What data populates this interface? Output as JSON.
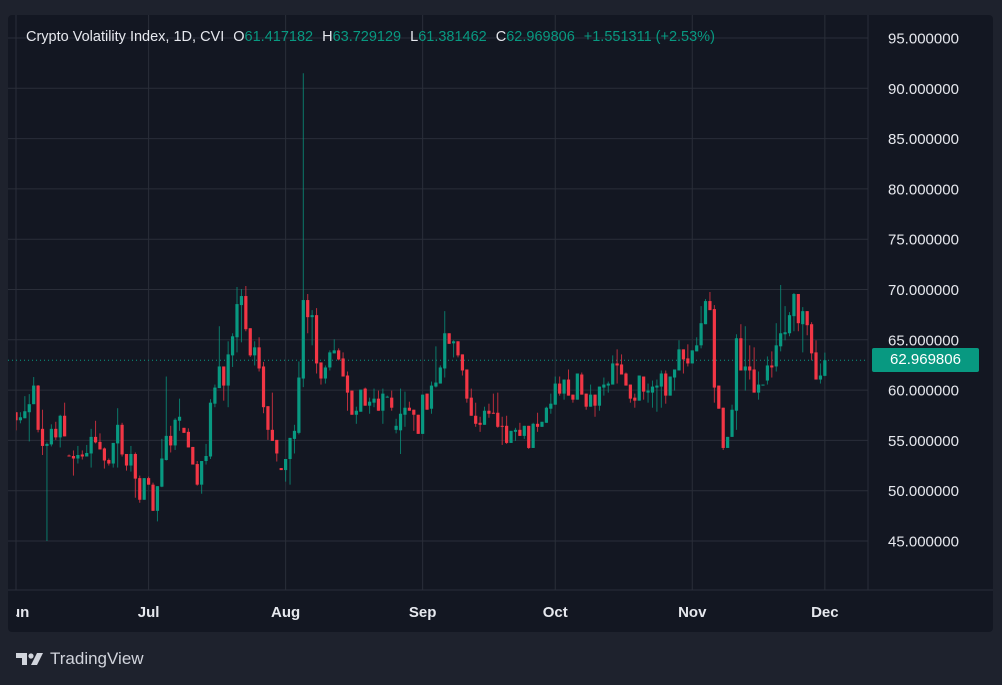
{
  "header": {
    "title": "Crypto Volatility Index, 1D, CVI",
    "open_label": "O",
    "open": "61.417182",
    "high_label": "H",
    "high": "63.729129",
    "low_label": "L",
    "low": "61.381462",
    "close_label": "C",
    "close": "62.969806",
    "change": "+1.551311 (+2.53%)"
  },
  "last_price": "62.969806",
  "branding": "TradingView",
  "colors": {
    "up": "#089981",
    "down": "#f23645",
    "background": "#131722",
    "grid": "#2a2e39"
  },
  "chart_data": {
    "type": "candlestick",
    "title": "Crypto Volatility Index, 1D, CVI",
    "interval": "1D",
    "ylim": [
      40,
      97
    ],
    "y_ticks": [
      "95.000000",
      "90.000000",
      "85.000000",
      "80.000000",
      "75.000000",
      "70.000000",
      "65.000000",
      "60.000000",
      "55.000000",
      "50.000000",
      "45.000000"
    ],
    "y_tick_values": [
      95,
      90,
      85,
      80,
      75,
      70,
      65,
      60,
      55,
      50,
      45
    ],
    "x_ticks": [
      {
        "label": "Jun",
        "index": 0
      },
      {
        "label": "Jul",
        "index": 30
      },
      {
        "label": "Aug",
        "index": 61
      },
      {
        "label": "Sep",
        "index": 92
      },
      {
        "label": "Oct",
        "index": 122
      },
      {
        "label": "Nov",
        "index": 153
      },
      {
        "label": "Dec",
        "index": 183
      }
    ],
    "grid": true,
    "last_value": 62.969806,
    "ohlc_fields": [
      "open",
      "high",
      "low",
      "close"
    ],
    "candles": [
      [
        57.8,
        57.8,
        56.0,
        57.0
      ],
      [
        57.0,
        57.8,
        56.7,
        57.3
      ],
      [
        57.2,
        59.4,
        57.2,
        57.9
      ],
      [
        57.8,
        59.6,
        54.9,
        58.6
      ],
      [
        58.6,
        61.3,
        58.6,
        60.45
      ],
      [
        60.45,
        60.5,
        55.8,
        56.05
      ],
      [
        56.15,
        58.05,
        53.55,
        54.45
      ],
      [
        54.45,
        54.8,
        45.0,
        54.65
      ],
      [
        54.6,
        56.6,
        54.4,
        56.15
      ],
      [
        56.15,
        56.85,
        55.05,
        55.3
      ],
      [
        55.3,
        57.55,
        54.3,
        57.45
      ],
      [
        57.45,
        58.75,
        55.4,
        55.4
      ],
      [
        53.5,
        53.6,
        53.4,
        53.4
      ],
      [
        53.45,
        54.0,
        51.5,
        53.2
      ],
      [
        53.2,
        54.45,
        52.7,
        53.55
      ],
      [
        53.6,
        54.0,
        53.1,
        53.4
      ],
      [
        53.4,
        54.55,
        53.4,
        53.75
      ],
      [
        53.7,
        56.15,
        52.3,
        55.35
      ],
      [
        55.35,
        56.95,
        54.7,
        54.8
      ],
      [
        54.85,
        55.7,
        54.1,
        54.1
      ],
      [
        54.2,
        54.3,
        52.2,
        53.0
      ],
      [
        53.05,
        53.2,
        52.5,
        52.7
      ],
      [
        52.7,
        54.75,
        52.3,
        54.75
      ],
      [
        54.7,
        58.2,
        52.3,
        56.55
      ],
      [
        56.55,
        56.75,
        53.4,
        53.6
      ],
      [
        53.65,
        53.65,
        52.0,
        52.5
      ],
      [
        52.5,
        54.45,
        51.9,
        53.65
      ],
      [
        53.65,
        53.8,
        49.3,
        51.2
      ],
      [
        51.25,
        51.5,
        48.8,
        49.1
      ],
      [
        49.1,
        51.25,
        49.1,
        51.25
      ],
      [
        51.25,
        51.4,
        50.6,
        50.6
      ],
      [
        50.6,
        50.8,
        48.0,
        48.0
      ],
      [
        48.0,
        50.45,
        46.95,
        50.45
      ],
      [
        50.4,
        55.15,
        50.35,
        53.2
      ],
      [
        53.05,
        61.35,
        53.0,
        55.45
      ],
      [
        55.45,
        56.45,
        53.8,
        54.5
      ],
      [
        54.5,
        57.2,
        54.05,
        57.05
      ],
      [
        56.95,
        59.15,
        55.95,
        57.35
      ],
      [
        56.25,
        56.25,
        55.75,
        55.75
      ],
      [
        55.85,
        56.2,
        54.3,
        54.3
      ],
      [
        54.35,
        54.35,
        52.6,
        52.6
      ],
      [
        52.65,
        52.95,
        50.5,
        50.6
      ],
      [
        50.6,
        52.95,
        49.7,
        52.95
      ],
      [
        52.95,
        54.65,
        52.6,
        53.45
      ],
      [
        53.4,
        59.1,
        53.15,
        58.75
      ],
      [
        58.65,
        60.55,
        58.3,
        60.25
      ],
      [
        60.2,
        66.35,
        60.2,
        62.35
      ],
      [
        62.35,
        62.35,
        58.95,
        60.45
      ],
      [
        60.45,
        64.85,
        58.3,
        63.55
      ],
      [
        63.45,
        65.65,
        62.3,
        65.35
      ],
      [
        65.25,
        70.25,
        63.75,
        68.55
      ],
      [
        68.45,
        70.05,
        64.75,
        69.35
      ],
      [
        69.35,
        70.35,
        65.85,
        66.05
      ],
      [
        66.15,
        66.15,
        63.3,
        63.45
      ],
      [
        63.45,
        64.85,
        62.45,
        64.25
      ],
      [
        64.25,
        65.25,
        61.85,
        62.15
      ],
      [
        62.35,
        62.8,
        57.7,
        58.3
      ],
      [
        58.4,
        58.4,
        55.05,
        56.05
      ],
      [
        56.05,
        59.75,
        54.95,
        54.95
      ],
      [
        55.05,
        55.05,
        52.9,
        53.7
      ],
      [
        52.25,
        52.25,
        52.05,
        52.05
      ],
      [
        52.05,
        53.15,
        50.9,
        53.15
      ],
      [
        53.15,
        55.25,
        50.6,
        55.25
      ],
      [
        55.15,
        56.55,
        53.7,
        55.95
      ],
      [
        55.75,
        62.85,
        55.6,
        61.25
      ],
      [
        61.15,
        91.5,
        60.3,
        68.95
      ],
      [
        68.95,
        69.55,
        65.65,
        67.25
      ],
      [
        67.25,
        67.95,
        64.45,
        67.45
      ],
      [
        67.45,
        68.15,
        61.65,
        62.65
      ],
      [
        62.75,
        62.75,
        60.55,
        61.15
      ],
      [
        61.15,
        62.45,
        60.65,
        62.25
      ],
      [
        62.25,
        63.95,
        61.95,
        63.75
      ],
      [
        63.65,
        65.05,
        63.65,
        63.95
      ],
      [
        63.95,
        64.15,
        62.95,
        63.05
      ],
      [
        63.15,
        63.75,
        61.35,
        61.35
      ],
      [
        61.45,
        61.85,
        57.95,
        59.75
      ],
      [
        59.95,
        59.95,
        57.55,
        57.55
      ],
      [
        57.55,
        58.35,
        56.65,
        57.95
      ],
      [
        57.85,
        60.05,
        57.85,
        60.05
      ],
      [
        60.15,
        60.25,
        58.45,
        58.45
      ],
      [
        58.45,
        59.25,
        57.65,
        58.85
      ],
      [
        58.75,
        60.15,
        58.3,
        59.15
      ],
      [
        59.15,
        59.95,
        57.95,
        57.95
      ],
      [
        57.95,
        60.15,
        56.65,
        59.65
      ],
      [
        59.25,
        59.45,
        59.25,
        59.35
      ],
      [
        59.25,
        59.95,
        57.95,
        58.25
      ],
      [
        56.05,
        57.15,
        55.7,
        56.45
      ],
      [
        56.0,
        60.15,
        53.65,
        57.65
      ],
      [
        57.55,
        59.85,
        56.35,
        58.25
      ],
      [
        58.25,
        58.85,
        57.95,
        57.95
      ],
      [
        58.05,
        58.05,
        55.95,
        57.55
      ],
      [
        57.55,
        57.55,
        55.65,
        55.65
      ],
      [
        55.65,
        59.55,
        55.65,
        59.55
      ],
      [
        59.65,
        59.65,
        58.05,
        58.05
      ],
      [
        58.15,
        60.85,
        57.65,
        60.45
      ],
      [
        60.35,
        64.35,
        60.25,
        60.75
      ],
      [
        60.65,
        62.45,
        60.65,
        62.25
      ],
      [
        62.15,
        67.85,
        61.25,
        65.65
      ],
      [
        65.65,
        65.65,
        64.6,
        64.6
      ],
      [
        64.65,
        64.95,
        63.25,
        64.85
      ],
      [
        64.85,
        64.85,
        63.25,
        63.45
      ],
      [
        63.55,
        63.55,
        61.45,
        61.95
      ],
      [
        62.05,
        62.05,
        58.75,
        59.15
      ],
      [
        59.25,
        60.15,
        57.45,
        57.45
      ],
      [
        57.45,
        58.75,
        56.35,
        56.65
      ],
      [
        56.75,
        57.35,
        55.85,
        56.55
      ],
      [
        56.55,
        58.35,
        56.55,
        57.95
      ],
      [
        57.95,
        58.65,
        57.25,
        57.65
      ],
      [
        57.75,
        59.65,
        57.65,
        57.65
      ],
      [
        57.75,
        59.75,
        56.25,
        56.35
      ],
      [
        56.45,
        57.35,
        54.55,
        56.35
      ],
      [
        56.45,
        57.45,
        54.65,
        54.75
      ],
      [
        54.75,
        55.95,
        54.75,
        55.95
      ],
      [
        55.85,
        56.25,
        54.95,
        56.05
      ],
      [
        56.05,
        56.75,
        55.45,
        55.45
      ],
      [
        55.45,
        56.45,
        55.15,
        56.45
      ],
      [
        56.45,
        56.45,
        54.15,
        54.25
      ],
      [
        54.25,
        56.75,
        54.25,
        56.65
      ],
      [
        56.65,
        57.75,
        55.85,
        56.35
      ],
      [
        56.35,
        56.85,
        56.35,
        56.85
      ],
      [
        56.75,
        58.35,
        56.75,
        58.25
      ],
      [
        58.15,
        59.65,
        57.65,
        58.65
      ],
      [
        58.55,
        61.35,
        58.55,
        60.65
      ],
      [
        60.65,
        61.35,
        59.45,
        59.65
      ],
      [
        59.65,
        61.05,
        59.05,
        61.05
      ],
      [
        61.05,
        62.05,
        59.45,
        59.45
      ],
      [
        59.55,
        59.55,
        58.75,
        59.05
      ],
      [
        59.05,
        61.65,
        59.05,
        61.65
      ],
      [
        61.55,
        61.75,
        59.55,
        59.55
      ],
      [
        59.65,
        59.65,
        58.05,
        58.35
      ],
      [
        58.35,
        60.55,
        58.35,
        59.55
      ],
      [
        59.55,
        59.55,
        57.35,
        58.45
      ],
      [
        58.45,
        60.35,
        57.95,
        60.35
      ],
      [
        60.25,
        61.25,
        59.45,
        60.55
      ],
      [
        60.45,
        60.85,
        59.75,
        60.65
      ],
      [
        60.55,
        63.45,
        60.55,
        62.65
      ],
      [
        62.65,
        64.05,
        60.65,
        62.45
      ],
      [
        62.55,
        63.55,
        61.55,
        61.55
      ],
      [
        61.65,
        61.75,
        60.45,
        60.45
      ],
      [
        60.55,
        60.55,
        58.75,
        59.15
      ],
      [
        59.25,
        59.65,
        58.25,
        58.95
      ],
      [
        58.95,
        61.45,
        58.95,
        61.45
      ],
      [
        61.35,
        61.35,
        59.05,
        59.85
      ],
      [
        59.75,
        60.65,
        58.75,
        59.95
      ],
      [
        59.75,
        60.95,
        58.25,
        60.35
      ],
      [
        60.25,
        61.05,
        57.85,
        60.45
      ],
      [
        60.35,
        61.95,
        58.25,
        61.65
      ],
      [
        61.65,
        61.95,
        58.65,
        59.45
      ],
      [
        59.45,
        61.35,
        59.45,
        61.35
      ],
      [
        61.25,
        62.05,
        59.95,
        62.05
      ],
      [
        61.95,
        64.95,
        61.95,
        64.05
      ],
      [
        64.05,
        64.05,
        61.65,
        63.05
      ],
      [
        63.15,
        64.55,
        62.35,
        62.65
      ],
      [
        62.65,
        63.95,
        62.65,
        63.95
      ],
      [
        63.85,
        65.25,
        63.85,
        64.45
      ],
      [
        64.45,
        68.35,
        64.15,
        66.65
      ],
      [
        66.55,
        69.05,
        66.55,
        68.85
      ],
      [
        68.85,
        69.75,
        67.95,
        67.95
      ],
      [
        68.05,
        68.45,
        58.75,
        60.25
      ],
      [
        60.45,
        60.45,
        58.15,
        58.15
      ],
      [
        58.25,
        58.25,
        54.05,
        54.25
      ],
      [
        54.25,
        55.35,
        54.25,
        55.35
      ],
      [
        55.35,
        58.55,
        55.35,
        58.05
      ],
      [
        57.95,
        65.55,
        56.05,
        65.15
      ],
      [
        65.15,
        66.55,
        61.95,
        61.95
      ],
      [
        61.95,
        66.35,
        59.95,
        62.35
      ],
      [
        62.35,
        64.45,
        61.05,
        61.95
      ],
      [
        62.05,
        64.25,
        59.75,
        59.75
      ],
      [
        59.75,
        61.85,
        59.05,
        60.55
      ],
      [
        60.45,
        60.55,
        60.45,
        60.55
      ],
      [
        60.95,
        63.35,
        60.55,
        62.45
      ],
      [
        62.45,
        63.85,
        61.25,
        62.25
      ],
      [
        62.35,
        66.65,
        61.85,
        64.45
      ],
      [
        64.35,
        70.45,
        63.85,
        65.65
      ],
      [
        65.55,
        68.35,
        64.95,
        65.75
      ],
      [
        65.65,
        67.75,
        65.35,
        67.45
      ],
      [
        67.35,
        69.65,
        65.85,
        69.55
      ],
      [
        69.55,
        69.55,
        65.85,
        66.65
      ],
      [
        66.55,
        68.25,
        63.75,
        67.85
      ],
      [
        67.85,
        67.85,
        65.45,
        66.45
      ],
      [
        66.55,
        66.75,
        62.95,
        63.65
      ],
      [
        63.75,
        64.95,
        61.05,
        61.05
      ],
      [
        61.05,
        62.65,
        60.65,
        61.45
      ],
      [
        61.417182,
        63.729129,
        61.381462,
        62.969806
      ]
    ]
  }
}
